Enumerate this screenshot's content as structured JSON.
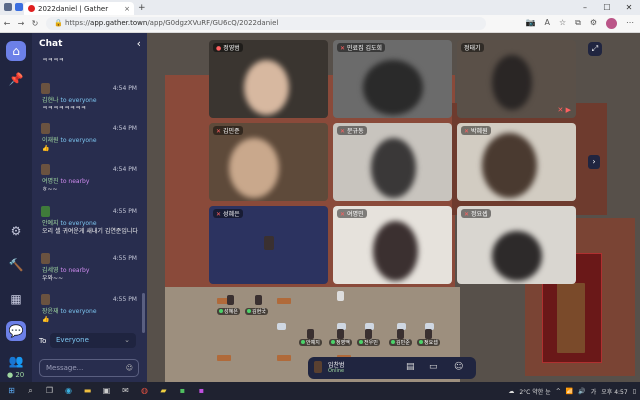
{
  "browser": {
    "tab_title": "2022daniel | Gather",
    "url_scheme": "https://",
    "url_host": "app.gather.town",
    "url_path": "/app/G0dgzXVuRF/GU6cQ/2022daniel"
  },
  "chat": {
    "title": "Chat",
    "messages": [
      {
        "sender": "",
        "recipient": "",
        "time": "",
        "body": "ㅋㅋㅋㅋ"
      },
      {
        "sender": "김현나",
        "recipient": "to everyone",
        "time": "4:54 PM",
        "body": "ㅋㅋㅋㅋㅋㅋㅋㅋ"
      },
      {
        "sender": "이재원",
        "recipient": "to everyone",
        "time": "4:54 PM",
        "body": "👍"
      },
      {
        "sender": "여명진",
        "recipient": "to nearby",
        "time": "4:54 PM",
        "body": "ㅎ~~"
      },
      {
        "sender": "안예지",
        "recipient": "to everyone",
        "time": "4:55 PM",
        "body": "오리 셀 귀여운게 새내기 김연준입니다"
      },
      {
        "sender": "김세영",
        "recipient": "to nearby",
        "time": "4:55 PM",
        "body": "우와~~"
      },
      {
        "sender": "장윤재",
        "recipient": "to everyone",
        "time": "4:55 PM",
        "body": "👍"
      }
    ],
    "to_label": "To",
    "to_value": "Everyone",
    "input_placeholder": "Message...",
    "online_count": "20"
  },
  "videos": [
    {
      "name": "정영범",
      "muted": false
    },
    {
      "name": "",
      "muted": true
    },
    {
      "name": "정태기",
      "muted": false
    },
    {
      "name": "김민준",
      "muted": true
    },
    {
      "name": "문규동",
      "muted": true
    },
    {
      "name": "박혜원",
      "muted": true
    },
    {
      "name": "성혜은",
      "muted": true
    },
    {
      "name": "여명민",
      "muted": true
    },
    {
      "name": "정요셉",
      "muted": true
    }
  ],
  "tile_badges": {
    "video_1": "민료집 김도희"
  },
  "nametags": [
    "성혜은",
    "김현국",
    "안예지",
    "정영맥",
    "전우민",
    "김민준",
    "정요셉"
  ],
  "me": {
    "name": "임찬범",
    "status": "Online"
  },
  "taskbar": {
    "weather": "2°C 약한 눈",
    "ime": "가",
    "clock": "오후 4:57"
  }
}
